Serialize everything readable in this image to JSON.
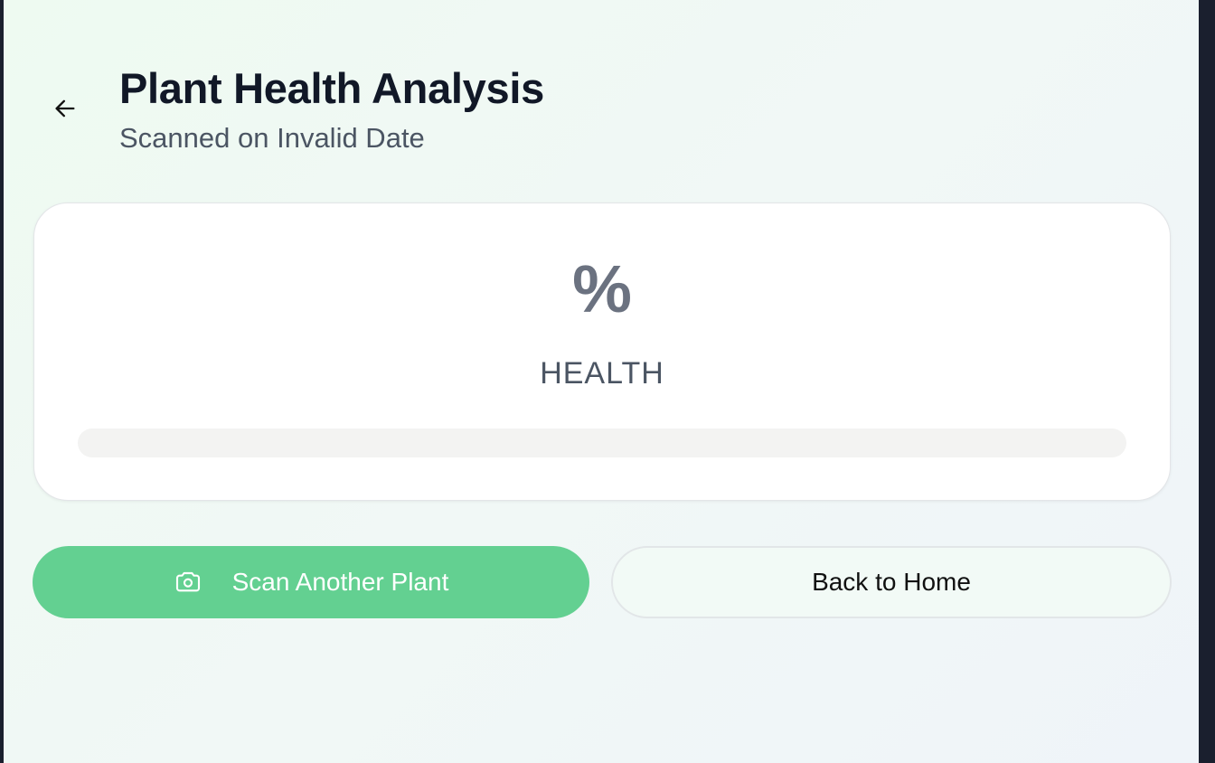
{
  "header": {
    "title": "Plant Health Analysis",
    "subtitle": "Scanned on Invalid Date",
    "back_icon": "arrow-left-icon"
  },
  "health_card": {
    "value": "%",
    "label": "HEALTH",
    "progress_fraction": 0
  },
  "actions": {
    "scan_label": "Scan Another Plant",
    "scan_icon": "camera-icon",
    "home_label": "Back to Home"
  },
  "colors": {
    "accent": "#63d091",
    "title": "#111827",
    "subtitle": "#4b5563",
    "health_value": "#6b7280",
    "progress_track": "#f3f3f2"
  }
}
